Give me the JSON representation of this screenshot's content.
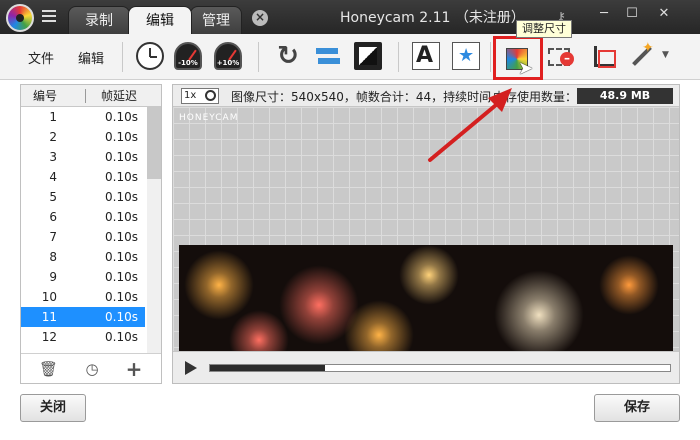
{
  "titlebar": {
    "tabs": [
      {
        "label": "录制",
        "active": false
      },
      {
        "label": "编辑",
        "active": true
      },
      {
        "label": "管理",
        "active": false
      }
    ],
    "tab_close": "×",
    "title": "Honeycam 2.11 （未注册）",
    "window_buttons": {
      "minimize": "─",
      "maximize": "☐",
      "close": "✕"
    }
  },
  "toolbar": {
    "file_label": "文件",
    "edit_label": "编辑",
    "speed_down": "-10%",
    "speed_up": "+10%",
    "tooltip": "调整尺寸",
    "icons": [
      "clock-icon",
      "speed-down-icon",
      "speed-up-icon",
      "rotate-icon",
      "flip-icon",
      "film-icon",
      "text-icon",
      "sticker-icon",
      "resize-icon",
      "frame-remove-icon",
      "crop-icon",
      "magic-icon"
    ]
  },
  "frame_list": {
    "col_no": "编号",
    "col_delay": "帧延迟",
    "rows": [
      {
        "no": "1",
        "delay": "0.10s"
      },
      {
        "no": "2",
        "delay": "0.10s"
      },
      {
        "no": "3",
        "delay": "0.10s"
      },
      {
        "no": "4",
        "delay": "0.10s"
      },
      {
        "no": "5",
        "delay": "0.10s"
      },
      {
        "no": "6",
        "delay": "0.10s"
      },
      {
        "no": "7",
        "delay": "0.10s"
      },
      {
        "no": "8",
        "delay": "0.10s"
      },
      {
        "no": "9",
        "delay": "0.10s"
      },
      {
        "no": "10",
        "delay": "0.10s"
      },
      {
        "no": "11",
        "delay": "0.10s",
        "selected": true
      },
      {
        "no": "12",
        "delay": "0.10s"
      }
    ]
  },
  "preview": {
    "zoom": "1x",
    "info": "图像尺寸：540x540，帧数合计：44，持续时间",
    "memory_label": "内存使用数量：",
    "memory_value": "48.9 MB",
    "watermark": "HONEYCAM",
    "progress": 0.25
  },
  "buttons": {
    "close": "关闭",
    "save": "保存"
  },
  "colors": {
    "selection": "#1e90ff",
    "highlight_box": "#e02020",
    "arrow": "#d42020"
  }
}
